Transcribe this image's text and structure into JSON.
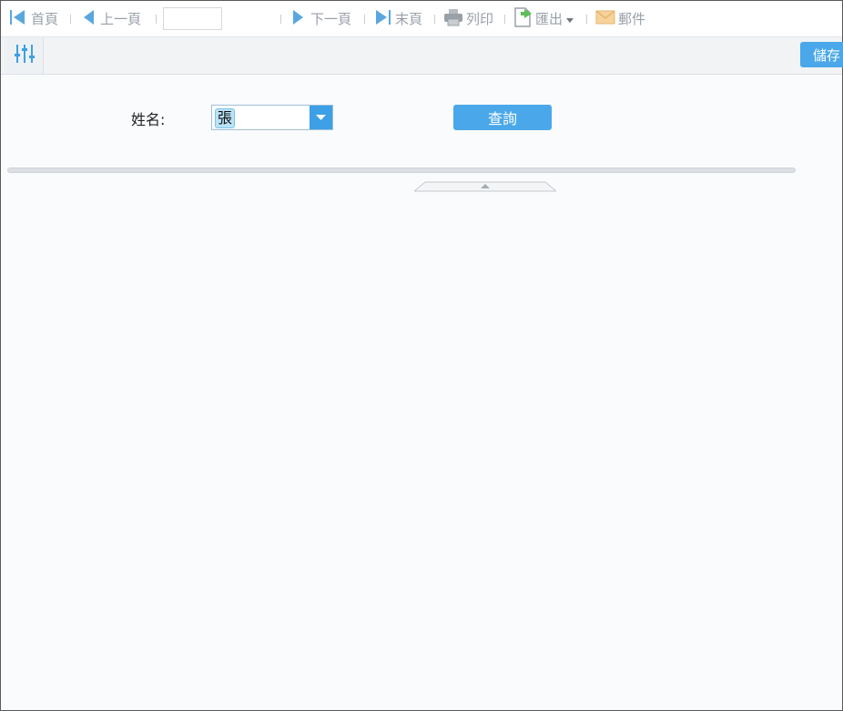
{
  "toolbar": {
    "first_label": "首頁",
    "prev_label": "上一頁",
    "page_value": "",
    "next_label": "下一頁",
    "last_label": "末頁",
    "print_label": "列印",
    "export_label": "匯出",
    "email_label": "郵件"
  },
  "subbar": {
    "save_label": "儲存"
  },
  "form": {
    "name_label": "姓名:",
    "name_value": "張",
    "query_label": "查詢"
  },
  "colors": {
    "accent": "#4aa8ea",
    "icon_gray": "#9aa0a8"
  },
  "icons": [
    "first-page-icon",
    "prev-page-icon",
    "next-page-icon",
    "last-page-icon",
    "print-icon",
    "export-icon",
    "dropdown-caret-icon",
    "email-icon",
    "parameter-settings-icon",
    "combo-arrow-icon",
    "collapse-toggle-icon"
  ]
}
